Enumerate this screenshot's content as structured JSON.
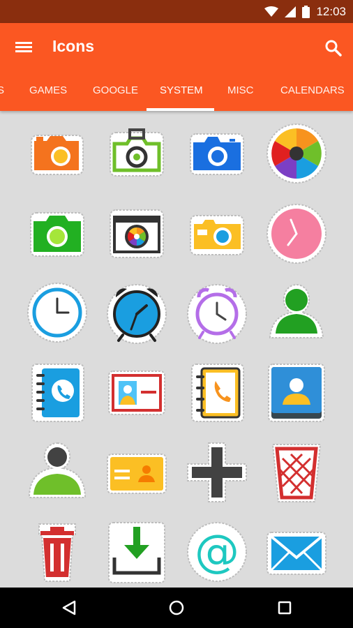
{
  "status_bar": {
    "time": "12:03"
  },
  "app_bar": {
    "title": "Icons"
  },
  "tabs": [
    {
      "label": "S"
    },
    {
      "label": "GAMES"
    },
    {
      "label": "GOOGLE"
    },
    {
      "label": "SYSTEM",
      "selected": true
    },
    {
      "label": "MISC"
    },
    {
      "label": "CALENDARS"
    }
  ],
  "grid": {
    "icons": [
      "camera-orange-icon",
      "camera-green-icon",
      "camera-blue-icon",
      "aperture-icon",
      "camera-green-flat-icon",
      "camera-dark-icon",
      "camera-yellow-icon",
      "clock-pink-icon",
      "clock-blue-icon",
      "alarm-clock-blue-icon",
      "alarm-clock-purple-icon",
      "contact-green-icon",
      "phonebook-blue-icon",
      "contact-card-icon",
      "phonebook-yellow-icon",
      "contacts-app-icon",
      "person-icon",
      "id-card-icon",
      "plus-icon",
      "trash-basket-icon",
      "trash-can-icon",
      "download-icon",
      "at-sign-icon",
      "email-icon"
    ]
  },
  "colors": {
    "app_bar": "#fb5722",
    "status_bar": "#8a2e0e",
    "background": "#dcdcdc"
  }
}
